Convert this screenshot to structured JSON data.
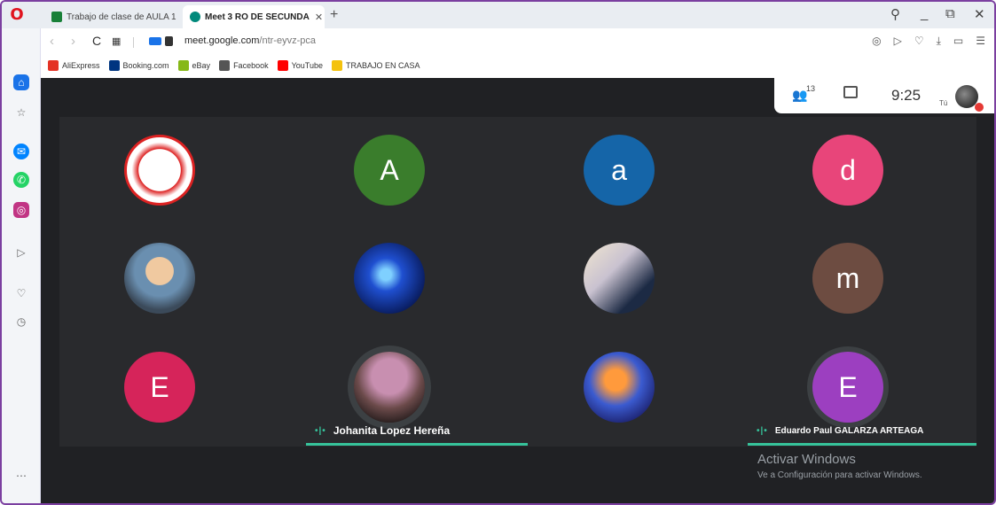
{
  "browser": {
    "tabs": [
      {
        "title": "Trabajo de clase de AULA 1",
        "close": "✕",
        "favicon_color": "#188038"
      },
      {
        "title": "Meet 3 RO  DE SECUNDA",
        "close": "✕",
        "favicon_color": "#00897b"
      }
    ],
    "new_tab": "+",
    "window_controls": {
      "search": "⚲",
      "minimize": "_",
      "restore": "⧉",
      "close": "✕"
    },
    "url_domain": "meet.google.com",
    "url_path": "/ntr-eyvz-pca",
    "bookmarks": [
      {
        "label": "AliExpress",
        "color": "#e43225"
      },
      {
        "label": "Booking.com",
        "color": "#003580"
      },
      {
        "label": "eBay",
        "color": "#86b817"
      },
      {
        "label": "Facebook",
        "color": "#555555"
      },
      {
        "label": "YouTube",
        "color": "#ff0000"
      },
      {
        "label": "TRABAJO EN CASA",
        "color": "#f4c20d"
      }
    ]
  },
  "meet": {
    "participants_count": "13",
    "time": "9:25",
    "self_label": "Tú",
    "tiles": [
      {
        "initial": "",
        "color": "#ffffff",
        "kind": "image-crest"
      },
      {
        "initial": "A",
        "color": "#3a7d2c",
        "kind": "letter"
      },
      {
        "initial": "a",
        "color": "#1565a8",
        "kind": "letter"
      },
      {
        "initial": "d",
        "color": "#e8457a",
        "kind": "letter"
      },
      {
        "initial": "",
        "color": "#7f8c9b",
        "kind": "image-person"
      },
      {
        "initial": "",
        "color": "#0b2a7a",
        "kind": "image-space"
      },
      {
        "initial": "",
        "color": "#c8c0b0",
        "kind": "image-anime"
      },
      {
        "initial": "m",
        "color": "#6d4c41",
        "kind": "letter"
      },
      {
        "initial": "E",
        "color": "#d6245a",
        "kind": "letter"
      },
      {
        "initial": "",
        "color": "#b48a8a",
        "kind": "image-girl"
      },
      {
        "initial": "",
        "color": "#3a4db0",
        "kind": "image-hero"
      },
      {
        "initial": "E",
        "color": "#9c3fc0",
        "kind": "letter"
      }
    ],
    "speakers": [
      {
        "name": "Johanita Lopez Hereña"
      },
      {
        "name": "Eduardo Paul GALARZA ARTEAGA"
      }
    ]
  },
  "watermark": {
    "title": "Activar Windows",
    "subtitle": "Ve a Configuración para activar Windows."
  },
  "colors": {
    "speaking": "#36c39b",
    "meet_bg": "#202124",
    "grid_bg": "#292a2d"
  }
}
